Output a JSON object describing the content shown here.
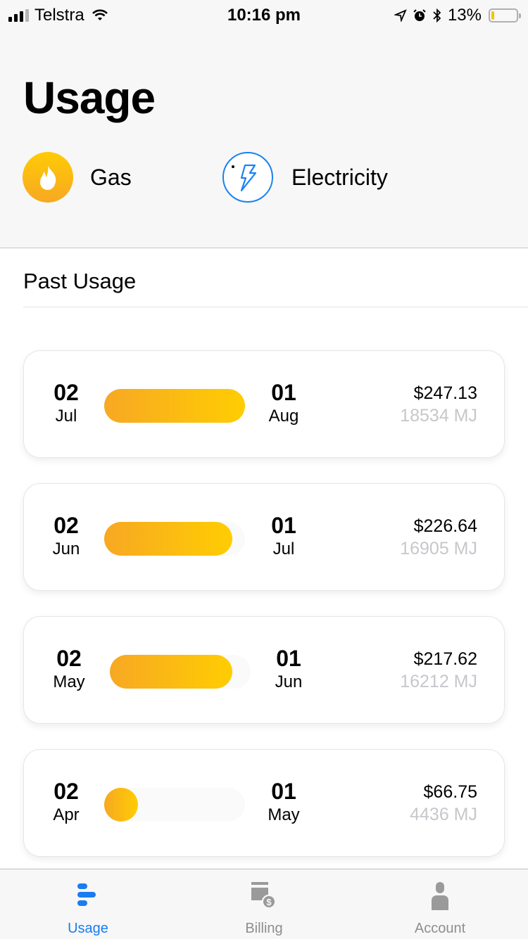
{
  "status_bar": {
    "carrier": "Telstra",
    "time": "10:16 pm",
    "battery_percent": "13%",
    "battery_level": 0.13
  },
  "header": {
    "title": "Usage",
    "fuel_tabs": [
      {
        "label": "Gas",
        "icon": "flame-icon",
        "selected": true
      },
      {
        "label": "Electricity",
        "icon": "lightning-bolt-icon",
        "selected": false
      }
    ]
  },
  "section": {
    "title": "Past Usage"
  },
  "usage_periods": [
    {
      "start_day": "02",
      "start_month": "Jul",
      "end_day": "01",
      "end_month": "Aug",
      "cost": "$247.13",
      "energy": "18534 MJ",
      "usage_fraction": 1.0
    },
    {
      "start_day": "02",
      "start_month": "Jun",
      "end_day": "01",
      "end_month": "Jul",
      "cost": "$226.64",
      "energy": "16905 MJ",
      "usage_fraction": 0.91
    },
    {
      "start_day": "02",
      "start_month": "May",
      "end_day": "01",
      "end_month": "Jun",
      "cost": "$217.62",
      "energy": "16212 MJ",
      "usage_fraction": 0.87
    },
    {
      "start_day": "02",
      "start_month": "Apr",
      "end_day": "01",
      "end_month": "May",
      "cost": "$66.75",
      "energy": "4436 MJ",
      "usage_fraction": 0.24
    }
  ],
  "tab_bar": {
    "items": [
      {
        "label": "Usage",
        "icon": "usage-bars-icon",
        "active": true
      },
      {
        "label": "Billing",
        "icon": "billing-card-icon",
        "active": false
      },
      {
        "label": "Account",
        "icon": "person-icon",
        "active": false
      }
    ]
  },
  "colors": {
    "accent_blue": "#1a7cf0",
    "gas_gradient_start": "#f7a823",
    "gas_gradient_end": "#ffcd02",
    "muted_text": "#c7c7cc",
    "inactive_tab": "#8e8e93"
  }
}
